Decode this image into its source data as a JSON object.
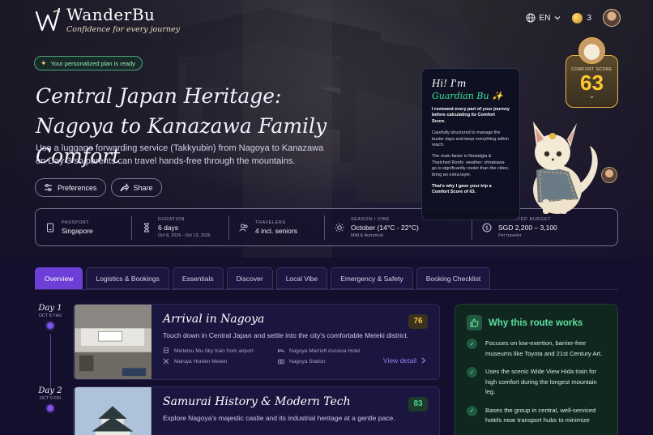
{
  "brand": {
    "name": "WanderBu",
    "tagline": "Confidence for every journey"
  },
  "topbar": {
    "language": "EN",
    "coins": "3"
  },
  "hero": {
    "badge": "Your personalized plan is ready",
    "title": "Central Japan Heritage: Nagoya to Kanazawa Family Comfort",
    "description": "Use a luggage forwarding service (Takkyubin) from Nagoya to Kanazawa on Day 3 so parents can travel hands-free through the mountains.",
    "preferences_label": "Preferences",
    "share_label": "Share"
  },
  "stats": [
    {
      "label": "Passport",
      "value": "Singapore",
      "sub": "",
      "icon": "passport-icon"
    },
    {
      "label": "Duration",
      "value": "6 days",
      "sub": "Oct 8, 2026 - Oct 13, 2026",
      "icon": "hourglass-icon"
    },
    {
      "label": "Travelers",
      "value": "4 incl. seniors",
      "sub": "",
      "icon": "people-icon"
    },
    {
      "label": "Season / Vibe",
      "value": "October (14°C - 22°C)",
      "sub": "Mild & Autumnal",
      "icon": "sun-icon"
    },
    {
      "label": "Estimated Budget",
      "value": "SGD 2,200 – 3,100",
      "sub": "Per traveler",
      "icon": "currency-icon"
    }
  ],
  "mascot": {
    "greeting": "Hi! I'm",
    "name": "Guardian Bu ✨",
    "paragraphs": [
      "I reviewed every part of your journey before calculating its Comfort Score.",
      "Carefully structured to manage the busier days and keep everything within reach.",
      "The main factor is Nostalgia & Thatched Roofs: weather: shirakawa-go is significantly cooler than the cities; bring an extra layer.",
      "That's why I gave your trip a Comfort Score of 63."
    ]
  },
  "comfort": {
    "label": "COMFORT SCORE",
    "value": "63"
  },
  "tabs": [
    "Overview",
    "Logistics & Bookings",
    "Essentials",
    "Discover",
    "Local Vibe",
    "Emergency & Safety",
    "Booking Checklist"
  ],
  "days": [
    {
      "label": "Day 1",
      "date": "OCT 8 THU",
      "title": "Arrival in Nagoya",
      "desc": "Touch down in Central Japan and settle into the city's comfortable Meieki district.",
      "score": "76",
      "chips": [
        "Meitetsu Mu-Sky train from airport",
        "Nagoya Marriott Associa Hotel",
        "Maruya Honten Meieki",
        "Nagoya Station"
      ],
      "view": "View detail"
    },
    {
      "label": "Day 2",
      "date": "OCT 9 FRI",
      "title": "Samurai History & Modern Tech",
      "desc": "Explore Nagoya's majestic castle and its industrial heritage at a gentle pace.",
      "score": "83"
    }
  ],
  "why": {
    "title": "Why this route works",
    "items": [
      "Focuses on low-exertion, barrier-free museums like Toyota and 21st Century Art.",
      "Uses the scenic Wide View Hida train for high comfort during the longest mountain leg.",
      "Bases the group in central, well-serviced hotels near transport hubs to minimize"
    ]
  },
  "colors": {
    "accent": "#6d3fd6",
    "mascot_name": "#38e39b",
    "comfort": "#ffc732",
    "why_title": "#5fe0a0"
  }
}
